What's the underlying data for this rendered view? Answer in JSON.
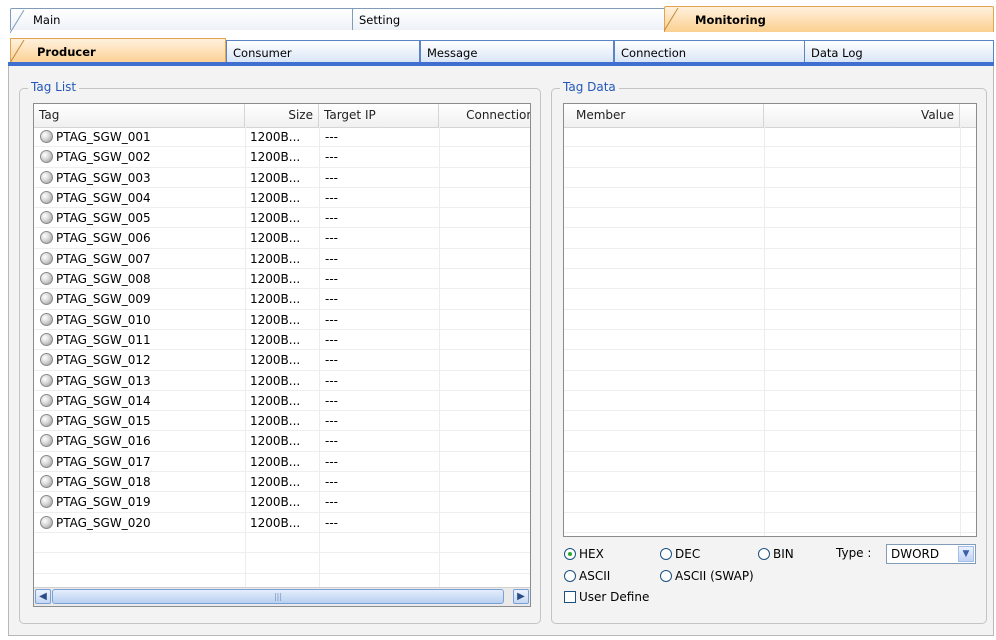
{
  "main_tabs": [
    {
      "label": "Main",
      "active": false
    },
    {
      "label": "Setting",
      "active": false
    },
    {
      "label": "Monitoring",
      "active": true
    }
  ],
  "sub_tabs": [
    {
      "label": "Producer",
      "active": true
    },
    {
      "label": "Consumer",
      "active": false
    },
    {
      "label": "Message",
      "active": false
    },
    {
      "label": "Connection",
      "active": false
    },
    {
      "label": "Data Log",
      "active": false
    }
  ],
  "tag_list": {
    "title": "Tag List",
    "columns": [
      "Tag",
      "Size",
      "Target IP",
      "Connection"
    ],
    "rows": [
      {
        "tag": "PTAG_SGW_001",
        "size": "1200B...",
        "target_ip": "---"
      },
      {
        "tag": "PTAG_SGW_002",
        "size": "1200B...",
        "target_ip": "---"
      },
      {
        "tag": "PTAG_SGW_003",
        "size": "1200B...",
        "target_ip": "---"
      },
      {
        "tag": "PTAG_SGW_004",
        "size": "1200B...",
        "target_ip": "---"
      },
      {
        "tag": "PTAG_SGW_005",
        "size": "1200B...",
        "target_ip": "---"
      },
      {
        "tag": "PTAG_SGW_006",
        "size": "1200B...",
        "target_ip": "---"
      },
      {
        "tag": "PTAG_SGW_007",
        "size": "1200B...",
        "target_ip": "---"
      },
      {
        "tag": "PTAG_SGW_008",
        "size": "1200B...",
        "target_ip": "---"
      },
      {
        "tag": "PTAG_SGW_009",
        "size": "1200B...",
        "target_ip": "---"
      },
      {
        "tag": "PTAG_SGW_010",
        "size": "1200B...",
        "target_ip": "---"
      },
      {
        "tag": "PTAG_SGW_011",
        "size": "1200B...",
        "target_ip": "---"
      },
      {
        "tag": "PTAG_SGW_012",
        "size": "1200B...",
        "target_ip": "---"
      },
      {
        "tag": "PTAG_SGW_013",
        "size": "1200B...",
        "target_ip": "---"
      },
      {
        "tag": "PTAG_SGW_014",
        "size": "1200B...",
        "target_ip": "---"
      },
      {
        "tag": "PTAG_SGW_015",
        "size": "1200B...",
        "target_ip": "---"
      },
      {
        "tag": "PTAG_SGW_016",
        "size": "1200B...",
        "target_ip": "---"
      },
      {
        "tag": "PTAG_SGW_017",
        "size": "1200B...",
        "target_ip": "---"
      },
      {
        "tag": "PTAG_SGW_018",
        "size": "1200B...",
        "target_ip": "---"
      },
      {
        "tag": "PTAG_SGW_019",
        "size": "1200B...",
        "target_ip": "---"
      },
      {
        "tag": "PTAG_SGW_020",
        "size": "1200B...",
        "target_ip": "---"
      }
    ],
    "status_icon": "status-led-gray-icon",
    "scroll_left_icon": "scroll-left-arrow-icon",
    "scroll_right_icon": "scroll-right-arrow-icon"
  },
  "tag_data": {
    "title": "Tag Data",
    "columns": [
      "Member",
      "Value"
    ],
    "format_options": [
      {
        "label": "HEX",
        "selected": true
      },
      {
        "label": "DEC",
        "selected": false
      },
      {
        "label": "BIN",
        "selected": false
      },
      {
        "label": "ASCII",
        "selected": false
      },
      {
        "label": "ASCII (SWAP)",
        "selected": false
      }
    ],
    "type_label": "Type :",
    "type_value": "DWORD",
    "user_define_label": "User Define",
    "user_define_checked": false
  },
  "colors": {
    "active_tab": "#fbcf8f",
    "tab_accent_bar": "#3e6fd1",
    "group_title": "#2458b8",
    "radio_selected": "#29a92f"
  }
}
